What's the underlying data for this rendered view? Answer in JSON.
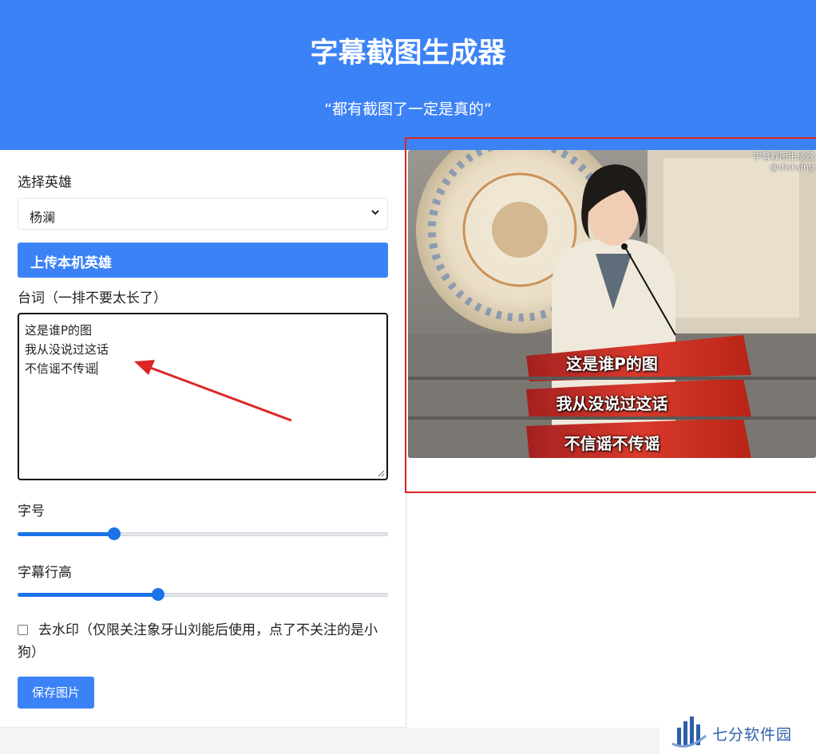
{
  "header": {
    "title": "字幕截图生成器",
    "subtitle": "“都有截图了一定是真的”"
  },
  "form": {
    "hero_label": "选择英雄",
    "hero_selected": "杨澜",
    "upload_label": "上传本机英雄",
    "lines_label": "台词（一排不要太长了）",
    "lines": [
      "这是谁P的图",
      "我从没说过这话",
      "不信谣不传谣"
    ],
    "font_size_label": "字号",
    "font_size_fraction": 0.26,
    "line_height_label": "字幕行高",
    "line_height_fraction": 0.38,
    "watermark_checked": false,
    "watermark_label": "去水印（仅限关注象牙山刘能后使用，点了不关注的是小狗）",
    "save_label": "保存图片"
  },
  "preview": {
    "watermark_lines": [
      "字幕截图生成器",
      "@disksing"
    ],
    "subtitles": [
      "这是谁P的图",
      "我从没说过这话",
      "不信谣不传谣"
    ]
  },
  "brand": {
    "name": "七分软件园"
  },
  "colors": {
    "primary": "#3b82f6",
    "slider": "#1a73e8",
    "annotation": "#dc2626"
  }
}
